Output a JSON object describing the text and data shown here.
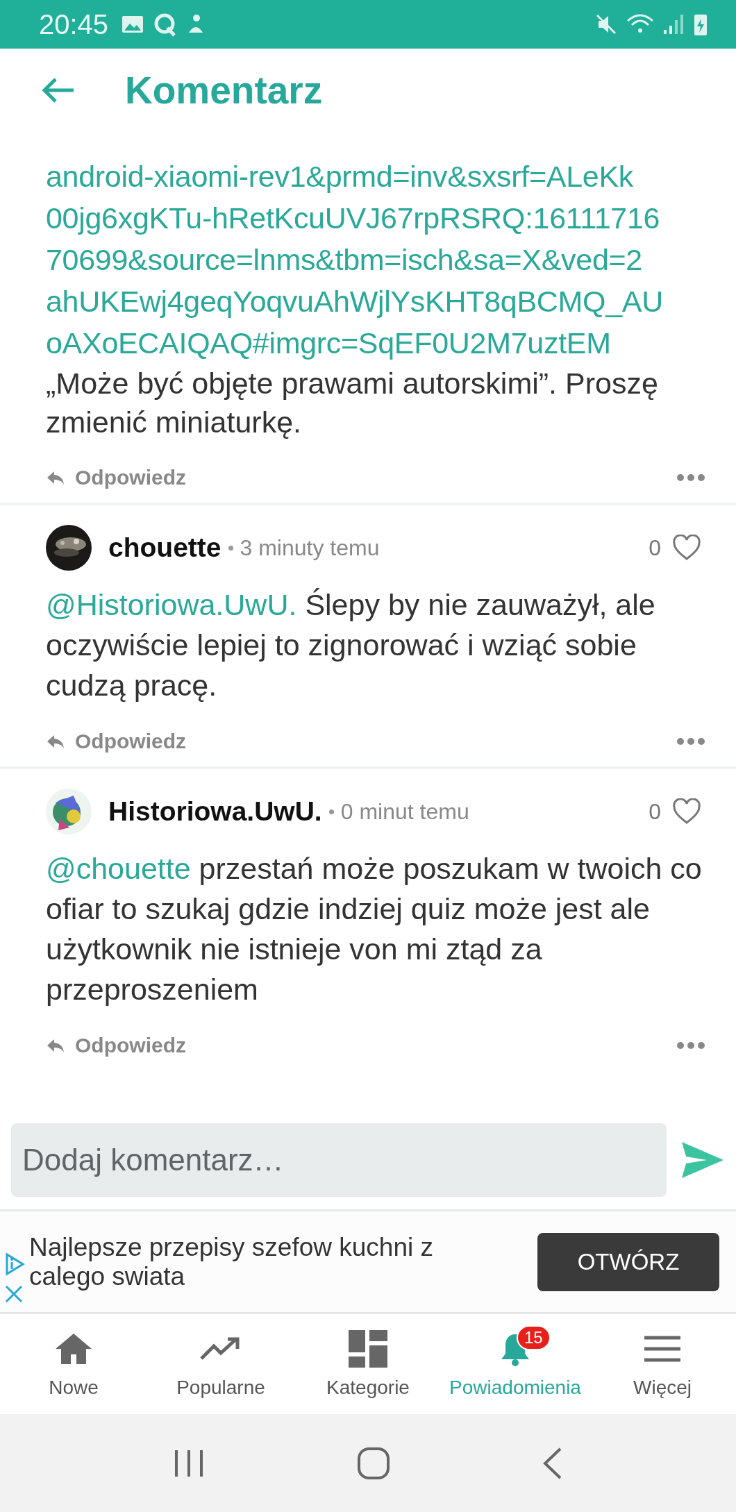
{
  "status_bar": {
    "time": "20:45"
  },
  "header": {
    "title": "Komentarz"
  },
  "first_comment": {
    "link_lines": [
      "android-xiaomi-rev1&prmd=inv&sxsrf=ALeKk",
      "00jg6xgKTu-hRetKcuUVJ67rpRSRQ:16111716",
      "70699&source=lnms&tbm=isch&sa=X&ved=2",
      "ahUKEwj4geqYoqvuAhWjlYsKHT8qBCMQ_AU",
      "oAXoECAIQAQ#imgrc=SqEF0U2M7uztEM"
    ],
    "text": "„Może być objęte prawami autorskimi”. Proszę zmienić miniaturkę.",
    "reply": "Odpowiedz"
  },
  "comments": [
    {
      "author": "chouette",
      "time": "3 minuty temu",
      "likes": "0",
      "mention": "@Historiowa.UwU.",
      "text": " Ślepy by nie zauważył, ale oczywiście lepiej to zignorować i wziąć sobie cudzą pracę.",
      "reply": "Odpowiedz"
    },
    {
      "author": "Historiowa.UwU.",
      "time": "0 minut temu",
      "likes": "0",
      "mention": "@chouette",
      "text": " przestań może poszukam w twoich co ofiar to szukaj gdzie indziej quiz może jest ale użytkownik nie istnieje von mi ztąd za przeproszeniem",
      "reply": "Odpowiedz"
    }
  ],
  "composer": {
    "placeholder": "Dodaj komentarz…"
  },
  "ad": {
    "text": "Najlepsze przepisy szefow kuchni z calego swiata",
    "button": "OTWÓRZ"
  },
  "bottom_nav": [
    {
      "kind": "home",
      "label": "Nowe",
      "selected": false
    },
    {
      "kind": "trend",
      "label": "Popularne",
      "selected": false
    },
    {
      "kind": "grid",
      "label": "Kategorie",
      "selected": false
    },
    {
      "kind": "bell",
      "label": "Powiadomienia",
      "selected": true,
      "badge": "15"
    },
    {
      "kind": "menu",
      "label": "Więcej",
      "selected": false
    }
  ]
}
